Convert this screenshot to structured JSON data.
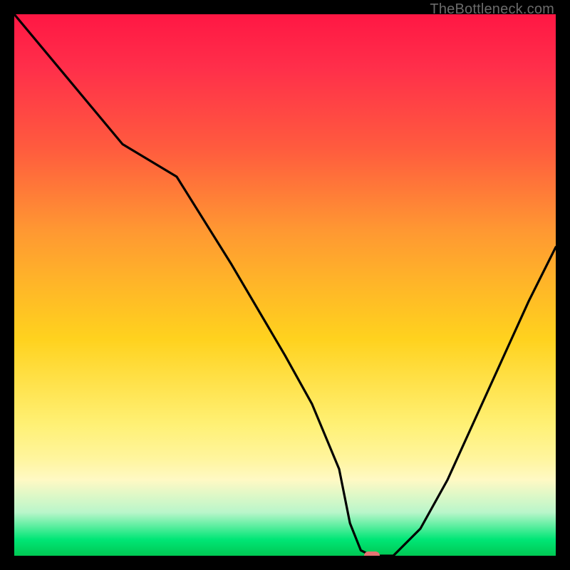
{
  "watermark": "TheBottleneck.com",
  "colors": {
    "background": "#000000",
    "gradient_top": "#ff1744",
    "gradient_mid": "#ffd21e",
    "gradient_bottom": "#00c853",
    "curve": "#000000",
    "marker": "#e57373"
  },
  "chart_data": {
    "type": "line",
    "title": "",
    "xlabel": "",
    "ylabel": "",
    "xlim": [
      0,
      100
    ],
    "ylim": [
      0,
      100
    ],
    "x": [
      0,
      10,
      20,
      30,
      40,
      50,
      55,
      60,
      62,
      64,
      66,
      70,
      75,
      80,
      85,
      90,
      95,
      100
    ],
    "values": [
      100,
      88,
      76,
      70,
      54,
      37,
      28,
      16,
      6,
      1,
      0,
      0,
      5,
      14,
      25,
      36,
      47,
      57
    ],
    "marker": {
      "x": 66,
      "y": 0
    },
    "series": [
      {
        "name": "bottleneck-curve",
        "x_ref": "x",
        "values_ref": "values"
      }
    ],
    "grid": false,
    "legend": false
  }
}
